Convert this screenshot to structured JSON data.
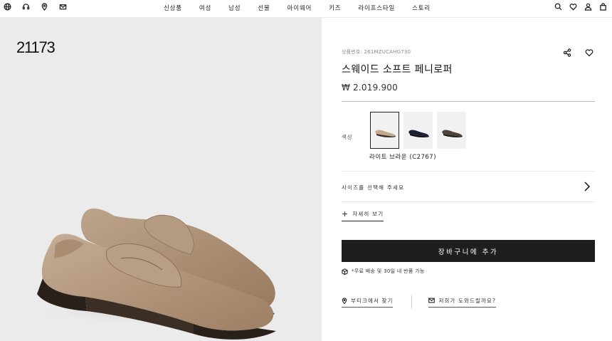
{
  "header": {
    "left_icons": [
      "globe-icon",
      "headset-icon",
      "location-pin-icon",
      "mail-icon"
    ],
    "nav": [
      "신상품",
      "여성",
      "남성",
      "선물",
      "아이웨어",
      "키즈",
      "라이프스타일",
      "스토리"
    ],
    "right_icons": [
      "search-icon",
      "heart-icon",
      "user-icon",
      "bag-icon"
    ]
  },
  "gallery": {
    "overlay_number": "21173"
  },
  "product": {
    "sku": "상품번호: 261MZUCAHG730",
    "title": "스웨이드 소프트 페니로퍼",
    "price": "₩ 2.019.900",
    "color_label": "색상",
    "selected_color_name": "라이트 브라운 (C2767)",
    "swatches": [
      {
        "name": "light-brown",
        "color": "#b59a80",
        "selected": true
      },
      {
        "name": "navy",
        "color": "#1c2236",
        "selected": false
      },
      {
        "name": "dark-brown",
        "color": "#4a3f35",
        "selected": false
      }
    ],
    "size_prompt": "사이즈를 선택해 주세요",
    "details_label": "자세히 보기",
    "add_to_bag": "장바구니에 추가",
    "shipping_note": "*무료 배송 및 30일 내 반품 가능",
    "find_boutique": "부티크에서 찾기",
    "need_help": "저희가 도와드릴까요?"
  },
  "colors": {
    "accent_dark": "#1e1e1e",
    "gallery_bg": "#ebebeb",
    "suede": "#b29a80"
  }
}
